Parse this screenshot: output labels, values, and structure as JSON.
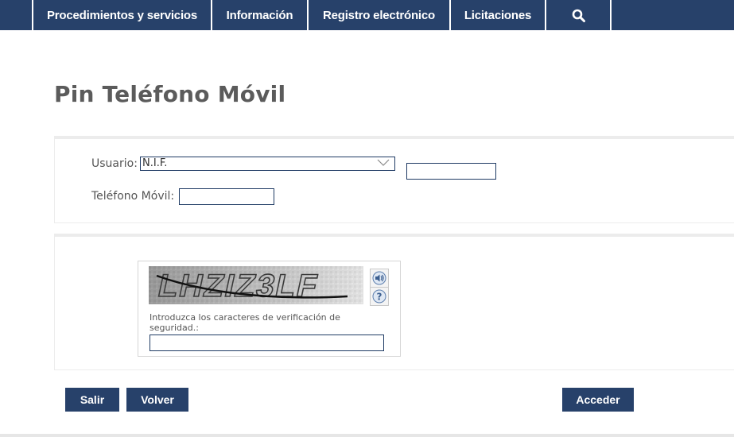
{
  "nav": {
    "items": [
      {
        "label": "Procedimientos y servicios"
      },
      {
        "label": "Información"
      },
      {
        "label": "Registro electrónico"
      },
      {
        "label": "Licitaciones"
      }
    ],
    "search_icon": "search-icon"
  },
  "page": {
    "title": "Pin Teléfono Móvil"
  },
  "form": {
    "usuario_label": "Usuario:",
    "usuario_type_value": "N.I.F.",
    "usuario_value": "",
    "telefono_label": "Teléfono Móvil:",
    "telefono_value": ""
  },
  "captcha": {
    "image_text": "LHZIZ3LF",
    "audio_icon": "speaker-icon",
    "help_icon": "help-icon",
    "instruction": "Introduzca los caracteres de verificación de seguridad.:",
    "value": ""
  },
  "actions": {
    "salir": "Salir",
    "volver": "Volver",
    "acceder": "Acceder"
  },
  "colors": {
    "primary": "#27416a",
    "title": "#5b5b5b"
  }
}
